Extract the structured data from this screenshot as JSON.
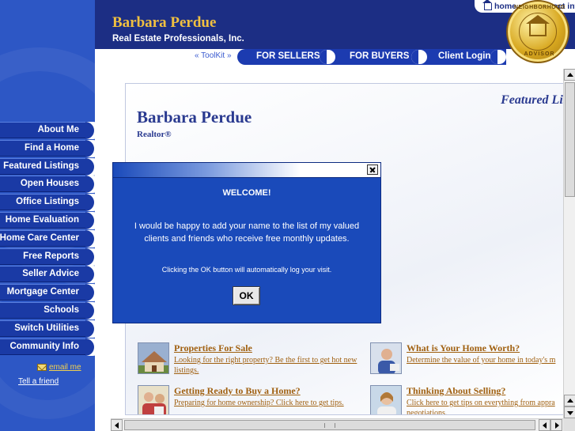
{
  "header": {
    "agent_name": "Barbara Perdue",
    "company": "Real Estate Professionals, Inc.",
    "util_links": {
      "home": "home",
      "contact": "contact info"
    }
  },
  "badge": {
    "top_text": "NEIGHBORHOOD",
    "bottom_text": "ADVISOR"
  },
  "topbar": {
    "toolkit": "« ToolKit »",
    "tabs": [
      "FOR SELLERS",
      "FOR BUYERS",
      "Client Login"
    ]
  },
  "sidebar": {
    "items": [
      "About Me",
      "Find a Home",
      "Featured Listings",
      "Open Houses",
      "Office Listings",
      "Home Evaluation",
      "Home Care Center",
      "Free Reports",
      "Seller Advice",
      "Mortgage Center",
      "Schools",
      "Switch Utilities",
      "Community Info"
    ],
    "email": "email me",
    "tell_friend": "Tell a friend"
  },
  "content": {
    "featured_heading": "Featured Lis",
    "agent_name": "Barbara Perdue",
    "agent_title": "Realtor®",
    "promos": [
      {
        "title": "Properties For Sale",
        "desc": "Looking for the right property? Be the first to get hot new listings."
      },
      {
        "title": "What is Your Home Worth?",
        "desc": "Determine the value of your home in today's m"
      },
      {
        "title": "Getting Ready to Buy a Home?",
        "desc": "Preparing for home ownership? Click here to get tips."
      },
      {
        "title": "Thinking About Selling?",
        "desc": "Click here to get tips on everything from appra negotiations."
      }
    ]
  },
  "modal": {
    "heading": "WELCOME!",
    "message": "I would be happy to add your name to the list of my valued clients and friends who receive free monthly updates.",
    "note": "Clicking the OK button will automatically log your visit.",
    "ok": "OK"
  },
  "colors": {
    "sidebar_bg": "#2d57c5",
    "header_bg": "#1c2e84",
    "accent_gold": "#f0c040",
    "modal_bg": "#1a4aba",
    "link_brown": "#a06010"
  }
}
